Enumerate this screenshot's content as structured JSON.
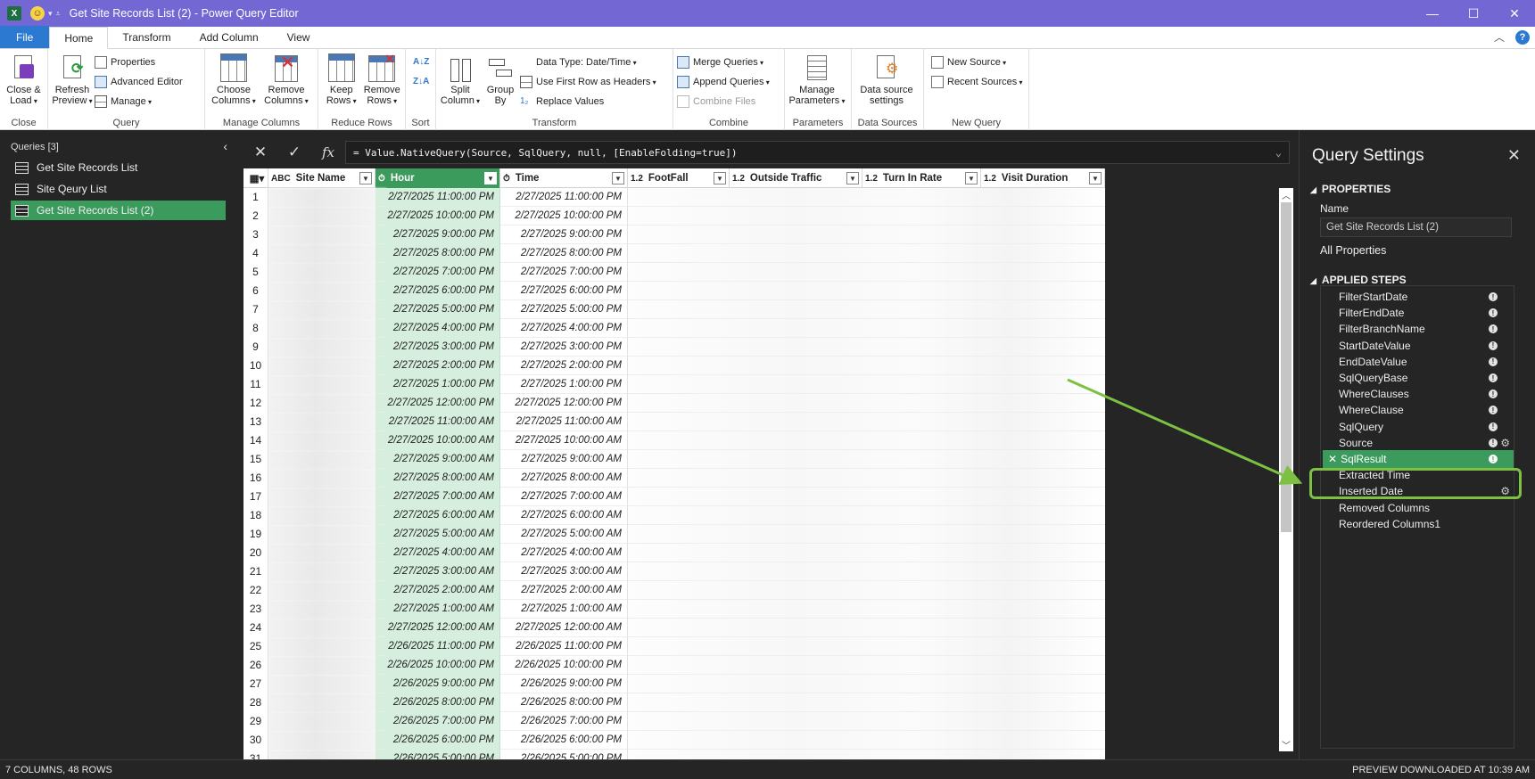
{
  "window": {
    "title": "Get Site Records List (2) - Power Query Editor",
    "app_logo": "X"
  },
  "ribbon_tabs": [
    "File",
    "Home",
    "Transform",
    "Add Column",
    "View"
  ],
  "ribbon": {
    "close_load": "Close & Load",
    "refresh_preview": "Refresh Preview",
    "properties": "Properties",
    "advanced_editor": "Advanced Editor",
    "manage": "Manage",
    "choose_columns": "Choose Columns",
    "remove_columns": "Remove Columns",
    "keep_rows": "Keep Rows",
    "remove_rows": "Remove Rows",
    "split_column": "Split Column",
    "group_by": "Group By",
    "data_type": "Data Type: Date/Time",
    "use_first_row": "Use First Row as Headers",
    "replace_values": "Replace Values",
    "merge_queries": "Merge Queries",
    "append_queries": "Append Queries",
    "combine_files": "Combine Files",
    "manage_parameters": "Manage Parameters",
    "data_source_settings": "Data source settings",
    "new_source": "New Source",
    "recent_sources": "Recent Sources",
    "groups": {
      "close": "Close",
      "query": "Query",
      "manage_columns": "Manage Columns",
      "reduce_rows": "Reduce Rows",
      "sort": "Sort",
      "transform": "Transform",
      "combine": "Combine",
      "parameters": "Parameters",
      "data_sources": "Data Sources",
      "new_query": "New Query"
    }
  },
  "queries_pane": {
    "header": "Queries [3]",
    "items": [
      "Get Site Records List",
      "Site Qeury List",
      "Get Site Records List (2)"
    ],
    "selected_index": 2
  },
  "formula_bar": {
    "formula": "= Value.NativeQuery(Source, SqlQuery, null, [EnableFolding=true])",
    "fx": "fx"
  },
  "grid": {
    "columns": [
      {
        "type": "ABC",
        "name": "Site Name"
      },
      {
        "type": "⏱",
        "name": "Hour"
      },
      {
        "type": "⏱",
        "name": "Time"
      },
      {
        "type": "1.2",
        "name": "FootFall"
      },
      {
        "type": "1.2",
        "name": "Outside Traffic"
      },
      {
        "type": "1.2",
        "name": "Turn In Rate"
      },
      {
        "type": "1.2",
        "name": "Visit Duration"
      }
    ],
    "selected_column": "Hour",
    "rows": [
      {
        "n": "1",
        "hour": "2/27/2025 11:00:00 PM",
        "time": "2/27/2025 11:00:00 PM"
      },
      {
        "n": "2",
        "hour": "2/27/2025 10:00:00 PM",
        "time": "2/27/2025 10:00:00 PM"
      },
      {
        "n": "3",
        "hour": "2/27/2025 9:00:00 PM",
        "time": "2/27/2025 9:00:00 PM"
      },
      {
        "n": "4",
        "hour": "2/27/2025 8:00:00 PM",
        "time": "2/27/2025 8:00:00 PM"
      },
      {
        "n": "5",
        "hour": "2/27/2025 7:00:00 PM",
        "time": "2/27/2025 7:00:00 PM"
      },
      {
        "n": "6",
        "hour": "2/27/2025 6:00:00 PM",
        "time": "2/27/2025 6:00:00 PM"
      },
      {
        "n": "7",
        "hour": "2/27/2025 5:00:00 PM",
        "time": "2/27/2025 5:00:00 PM"
      },
      {
        "n": "8",
        "hour": "2/27/2025 4:00:00 PM",
        "time": "2/27/2025 4:00:00 PM"
      },
      {
        "n": "9",
        "hour": "2/27/2025 3:00:00 PM",
        "time": "2/27/2025 3:00:00 PM"
      },
      {
        "n": "10",
        "hour": "2/27/2025 2:00:00 PM",
        "time": "2/27/2025 2:00:00 PM"
      },
      {
        "n": "11",
        "hour": "2/27/2025 1:00:00 PM",
        "time": "2/27/2025 1:00:00 PM"
      },
      {
        "n": "12",
        "hour": "2/27/2025 12:00:00 PM",
        "time": "2/27/2025 12:00:00 PM"
      },
      {
        "n": "13",
        "hour": "2/27/2025 11:00:00 AM",
        "time": "2/27/2025 11:00:00 AM"
      },
      {
        "n": "14",
        "hour": "2/27/2025 10:00:00 AM",
        "time": "2/27/2025 10:00:00 AM"
      },
      {
        "n": "15",
        "hour": "2/27/2025 9:00:00 AM",
        "time": "2/27/2025 9:00:00 AM"
      },
      {
        "n": "16",
        "hour": "2/27/2025 8:00:00 AM",
        "time": "2/27/2025 8:00:00 AM"
      },
      {
        "n": "17",
        "hour": "2/27/2025 7:00:00 AM",
        "time": "2/27/2025 7:00:00 AM"
      },
      {
        "n": "18",
        "hour": "2/27/2025 6:00:00 AM",
        "time": "2/27/2025 6:00:00 AM"
      },
      {
        "n": "19",
        "hour": "2/27/2025 5:00:00 AM",
        "time": "2/27/2025 5:00:00 AM"
      },
      {
        "n": "20",
        "hour": "2/27/2025 4:00:00 AM",
        "time": "2/27/2025 4:00:00 AM"
      },
      {
        "n": "21",
        "hour": "2/27/2025 3:00:00 AM",
        "time": "2/27/2025 3:00:00 AM"
      },
      {
        "n": "22",
        "hour": "2/27/2025 2:00:00 AM",
        "time": "2/27/2025 2:00:00 AM"
      },
      {
        "n": "23",
        "hour": "2/27/2025 1:00:00 AM",
        "time": "2/27/2025 1:00:00 AM"
      },
      {
        "n": "24",
        "hour": "2/27/2025 12:00:00 AM",
        "time": "2/27/2025 12:00:00 AM"
      },
      {
        "n": "25",
        "hour": "2/26/2025 11:00:00 PM",
        "time": "2/26/2025 11:00:00 PM"
      },
      {
        "n": "26",
        "hour": "2/26/2025 10:00:00 PM",
        "time": "2/26/2025 10:00:00 PM"
      },
      {
        "n": "27",
        "hour": "2/26/2025 9:00:00 PM",
        "time": "2/26/2025 9:00:00 PM"
      },
      {
        "n": "28",
        "hour": "2/26/2025 8:00:00 PM",
        "time": "2/26/2025 8:00:00 PM"
      },
      {
        "n": "29",
        "hour": "2/26/2025 7:00:00 PM",
        "time": "2/26/2025 7:00:00 PM"
      },
      {
        "n": "30",
        "hour": "2/26/2025 6:00:00 PM",
        "time": "2/26/2025 6:00:00 PM"
      },
      {
        "n": "31",
        "hour": "2/26/2025 5:00:00 PM",
        "time": "2/26/2025 5:00:00 PM"
      }
    ]
  },
  "settings": {
    "title": "Query Settings",
    "properties_header": "PROPERTIES",
    "name_label": "Name",
    "name_value": "Get Site Records List (2)",
    "all_properties": "All Properties",
    "applied_steps_header": "APPLIED STEPS",
    "steps": [
      {
        "name": "FilterStartDate",
        "info": true,
        "gear": false
      },
      {
        "name": "FilterEndDate",
        "info": true,
        "gear": false
      },
      {
        "name": "FilterBranchName",
        "info": true,
        "gear": false
      },
      {
        "name": "StartDateValue",
        "info": true,
        "gear": false
      },
      {
        "name": "EndDateValue",
        "info": true,
        "gear": false
      },
      {
        "name": "SqlQueryBase",
        "info": true,
        "gear": false
      },
      {
        "name": "WhereClauses",
        "info": true,
        "gear": false
      },
      {
        "name": "WhereClause",
        "info": true,
        "gear": false
      },
      {
        "name": "SqlQuery",
        "info": true,
        "gear": false
      },
      {
        "name": "Source",
        "info": true,
        "gear": true
      },
      {
        "name": "SqlResult",
        "info": true,
        "gear": false
      },
      {
        "name": "Extracted Time",
        "info": false,
        "gear": false
      },
      {
        "name": "Inserted Date",
        "info": false,
        "gear": true
      },
      {
        "name": "Removed Columns",
        "info": false,
        "gear": false
      },
      {
        "name": "Reordered Columns1",
        "info": false,
        "gear": false
      }
    ],
    "selected_step": "SqlResult"
  },
  "status": {
    "left": "7 COLUMNS, 48 ROWS",
    "right": "PREVIEW DOWNLOADED AT 10:39 AM"
  },
  "colors": {
    "title_bar": "#7367d4",
    "selection_green": "#3a9b5c",
    "annotation_green": "#7cc141",
    "file_tab_blue": "#2b79d0"
  }
}
